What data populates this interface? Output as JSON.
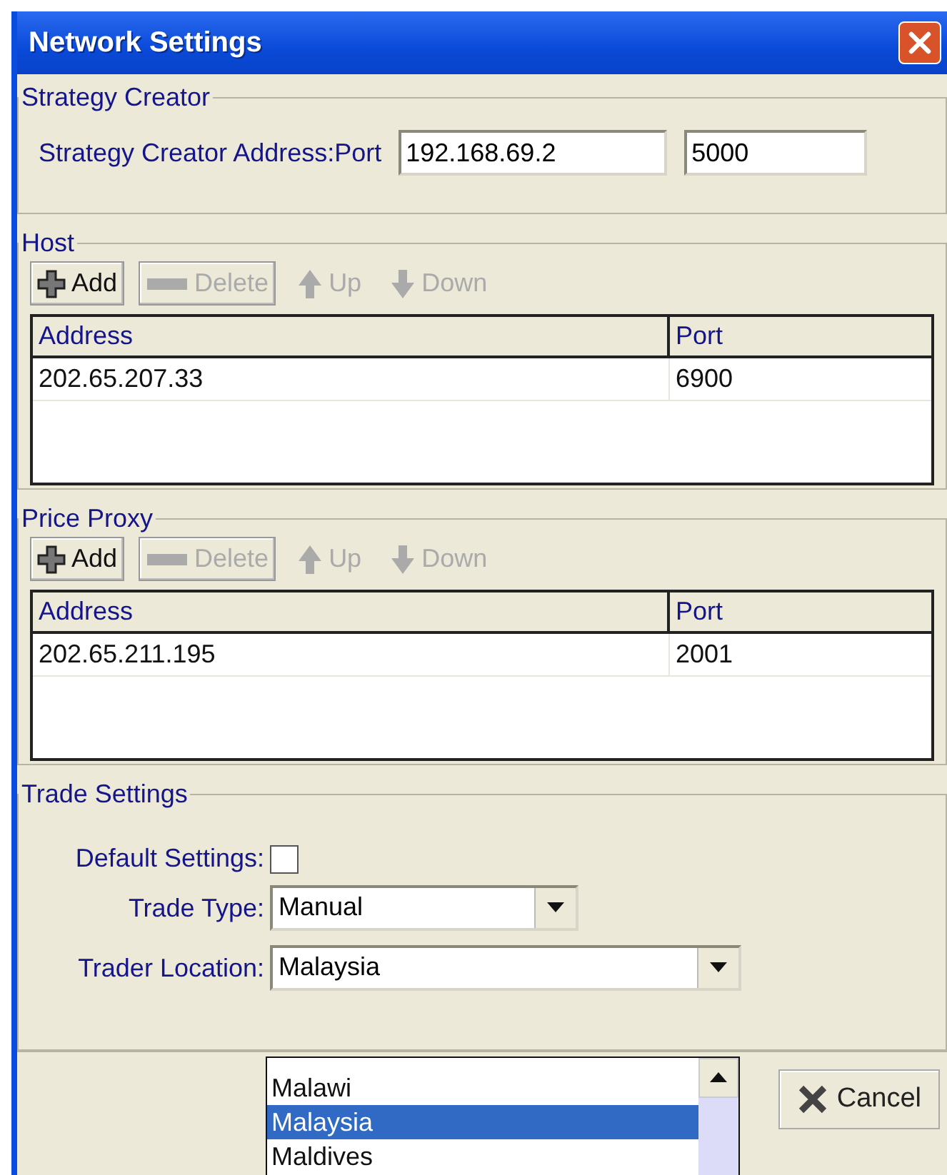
{
  "window": {
    "title": "Network Settings"
  },
  "strategy_creator": {
    "title": "Strategy Creator",
    "label": "Strategy Creator Address:Port",
    "address": "192.168.69.2",
    "port": "5000"
  },
  "host": {
    "title": "Host",
    "toolbar": [
      {
        "kind": "add",
        "label": "Add",
        "disabled": false
      },
      {
        "kind": "delete",
        "label": "Delete",
        "disabled": true
      },
      {
        "kind": "up",
        "label": "Up",
        "disabled": true
      },
      {
        "kind": "down",
        "label": "Down",
        "disabled": true
      }
    ],
    "table": {
      "columns": [
        "Address",
        "Port"
      ],
      "rows": [
        [
          "202.65.207.33",
          "6900"
        ]
      ]
    }
  },
  "price_proxy": {
    "title": "Price Proxy",
    "toolbar": [
      {
        "kind": "add",
        "label": "Add",
        "disabled": false
      },
      {
        "kind": "delete",
        "label": "Delete",
        "disabled": true
      },
      {
        "kind": "up",
        "label": "Up",
        "disabled": true
      },
      {
        "kind": "down",
        "label": "Down",
        "disabled": true
      }
    ],
    "table": {
      "columns": [
        "Address",
        "Port"
      ],
      "rows": [
        [
          "202.65.211.195",
          "2001"
        ]
      ]
    }
  },
  "trade_settings": {
    "title": "Trade Settings",
    "default_settings": {
      "label": "Default Settings:",
      "checked": false
    },
    "trade_type": {
      "label": "Trade Type:",
      "value": "Manual"
    },
    "trader_location": {
      "label": "Trader Location:",
      "value": "Malaysia",
      "options": [
        {
          "label": "Malawi",
          "selected": false
        },
        {
          "label": "Malaysia",
          "selected": true
        },
        {
          "label": "Maldives",
          "selected": false
        }
      ]
    }
  },
  "buttons": [
    {
      "kind": "cancel",
      "label": "Cancel"
    }
  ]
}
